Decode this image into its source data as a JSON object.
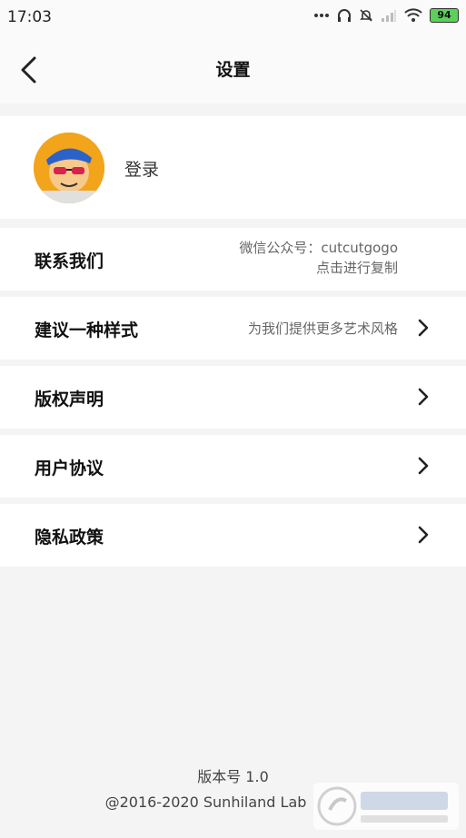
{
  "status_bar": {
    "time": "17:03",
    "battery": "94"
  },
  "nav": {
    "title": "设置"
  },
  "profile": {
    "login_label": "登录"
  },
  "rows": [
    {
      "label": "联系我们",
      "sub_line1": "微信公众号：cutcutgogo",
      "sub_line2": "点击进行复制"
    },
    {
      "label": "建议一种样式",
      "sub": "为我们提供更多艺术风格"
    },
    {
      "label": "版权声明"
    },
    {
      "label": "用户协议"
    },
    {
      "label": "隐私政策"
    }
  ],
  "footer": {
    "version": "版本号 1.0",
    "copyright": "@2016-2020 Sunhiland Lab"
  },
  "colors": {
    "background": "#f4f4f4",
    "card": "#ffffff",
    "battery": "#5bd05b"
  }
}
